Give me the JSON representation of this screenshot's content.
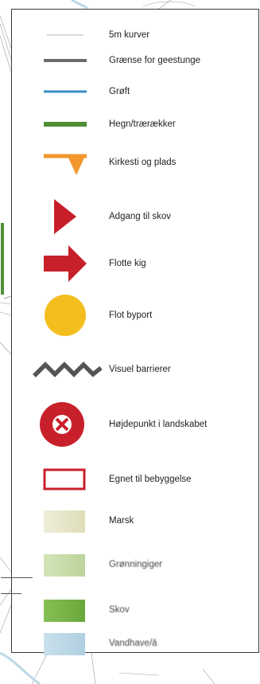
{
  "legend": {
    "items": [
      {
        "id": "contour",
        "label": "5m kurver",
        "icon": "thin-line",
        "color": "#9a9a9a"
      },
      {
        "id": "boundary",
        "label": "Grænse for geestunge",
        "icon": "gray-thick-line",
        "color": "#6d6d6d"
      },
      {
        "id": "ditch",
        "label": "Grøft",
        "icon": "blue-line",
        "color": "#3a8fc7"
      },
      {
        "id": "hedge",
        "label": "Hegn/trærækker",
        "icon": "green-line",
        "color": "#4f8f35"
      },
      {
        "id": "church-path",
        "label": "Kirkesti og plads",
        "icon": "orange-line-triangle",
        "color": "#f2972e"
      },
      {
        "id": "forest-access",
        "label": "Adgang til skov",
        "icon": "red-triangle",
        "color": "#c8202b"
      },
      {
        "id": "views",
        "label": "Flotte kig",
        "icon": "red-arrow",
        "color": "#c8202b"
      },
      {
        "id": "town-gate",
        "label": "Flot byport",
        "icon": "yellow-circle",
        "color": "#f4be1f"
      },
      {
        "id": "visual-barrier",
        "label": "Visuel barrierer",
        "icon": "zigzag-line",
        "color": "#555555"
      },
      {
        "id": "highpoint",
        "label": "Højdepunkt i landskabet",
        "icon": "red-circle-x",
        "color": "#c8202b"
      },
      {
        "id": "building-site",
        "label": "Egnet til bebyggelse",
        "icon": "red-outline-rect",
        "color": "#c8202b"
      },
      {
        "id": "marsh",
        "label": "Marsk",
        "icon": "marsh-swatch",
        "color": "#e6e5c6"
      },
      {
        "id": "meadow",
        "label": "Grønningiger",
        "icon": "meadow-swatch",
        "color": "#c7dba8"
      },
      {
        "id": "forest",
        "label": "Skov",
        "icon": "forest-swatch",
        "color": "#7bb549"
      },
      {
        "id": "water",
        "label": "Vandhave/å",
        "icon": "water-swatch",
        "color": "#bcd7e6"
      }
    ]
  }
}
